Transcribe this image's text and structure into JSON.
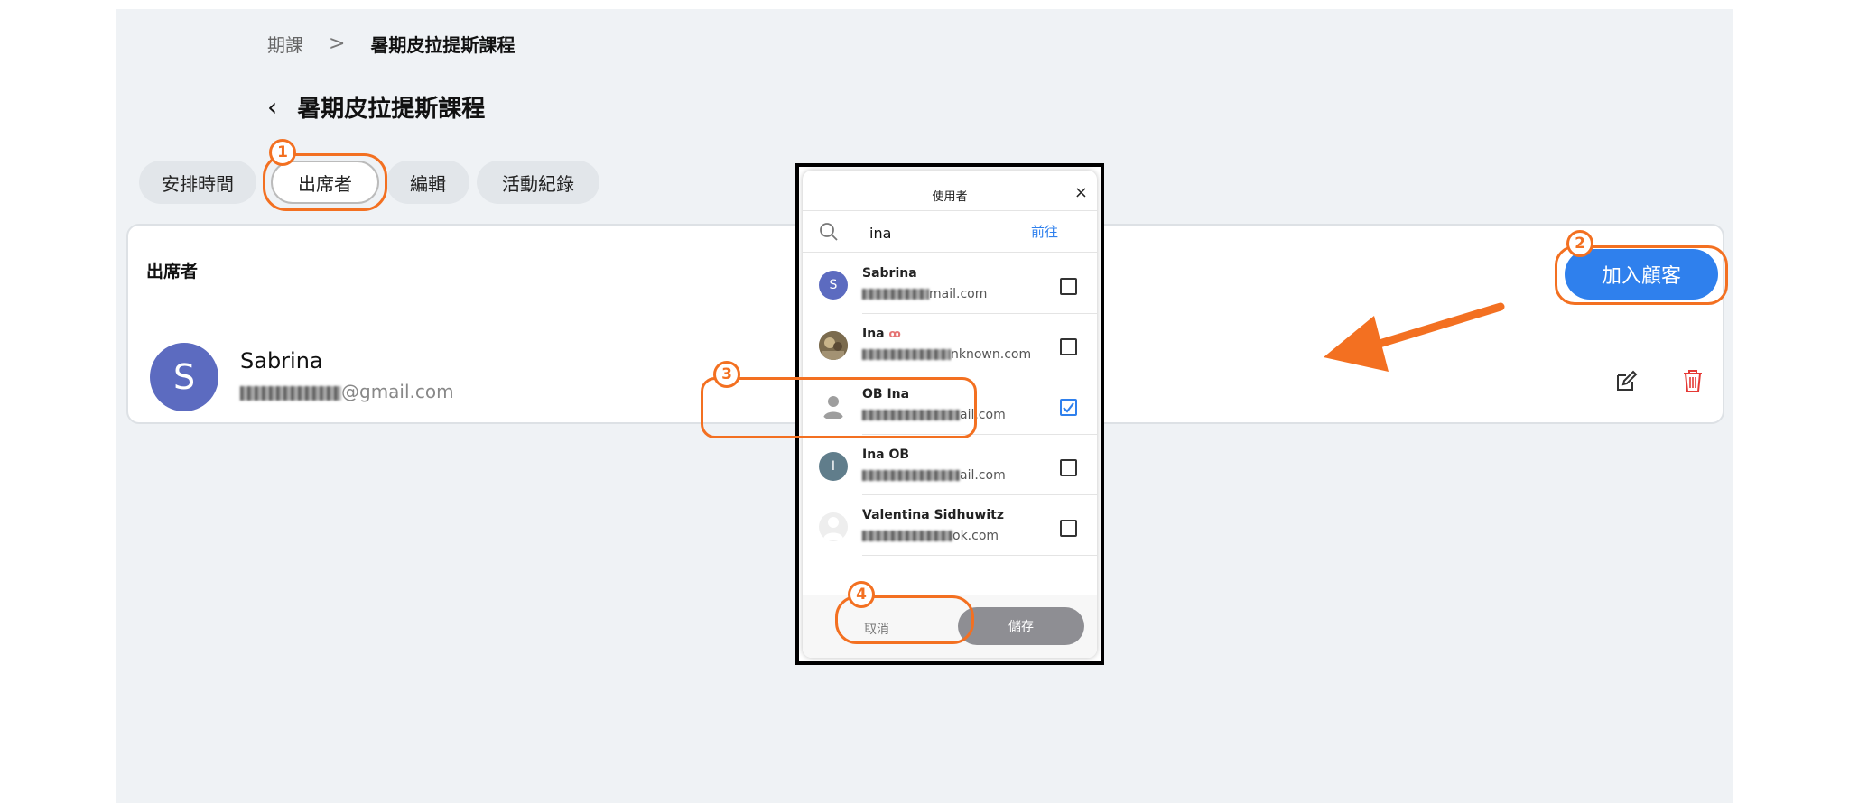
{
  "breadcrumb": {
    "parent": "期課",
    "separator": ">",
    "current": "暑期皮拉提斯課程"
  },
  "header": {
    "back": "‹",
    "title": "暑期皮拉提斯課程"
  },
  "tabs": [
    {
      "label": "安排時間"
    },
    {
      "label": "出席者"
    },
    {
      "label": "編輯"
    },
    {
      "label": "活動紀錄"
    }
  ],
  "panel": {
    "title": "出席者",
    "attendee": {
      "initial": "S",
      "name": "Sabrina",
      "email_suffix": "@gmail.com"
    },
    "add_button": "加入顧客"
  },
  "dialog": {
    "title": "使用者",
    "close": "×",
    "search_value": "ina",
    "go_label": "前往",
    "users": [
      {
        "name": "Sabrina",
        "initial": "S",
        "email_suffix": "mail.com",
        "checked": false
      },
      {
        "name": "Ina",
        "initial": "",
        "email_suffix": "nknown.com",
        "checked": false
      },
      {
        "name": "OB Ina",
        "initial": "",
        "email_suffix": "ail.com",
        "checked": true
      },
      {
        "name": "Ina OB",
        "initial": "I",
        "email_suffix": "ail.com",
        "checked": false
      },
      {
        "name": "Valentina Sidhuwitz",
        "initial": "",
        "email_suffix": "ok.com",
        "checked": false
      }
    ],
    "cancel_label": "取消",
    "save_label": "儲存"
  },
  "annotations": {
    "step1": "1",
    "step2": "2",
    "step3": "3",
    "step4": "4"
  },
  "colors": {
    "accent": "#2f80ed",
    "highlight": "#f37021",
    "page_bg": "#eff2f5"
  }
}
